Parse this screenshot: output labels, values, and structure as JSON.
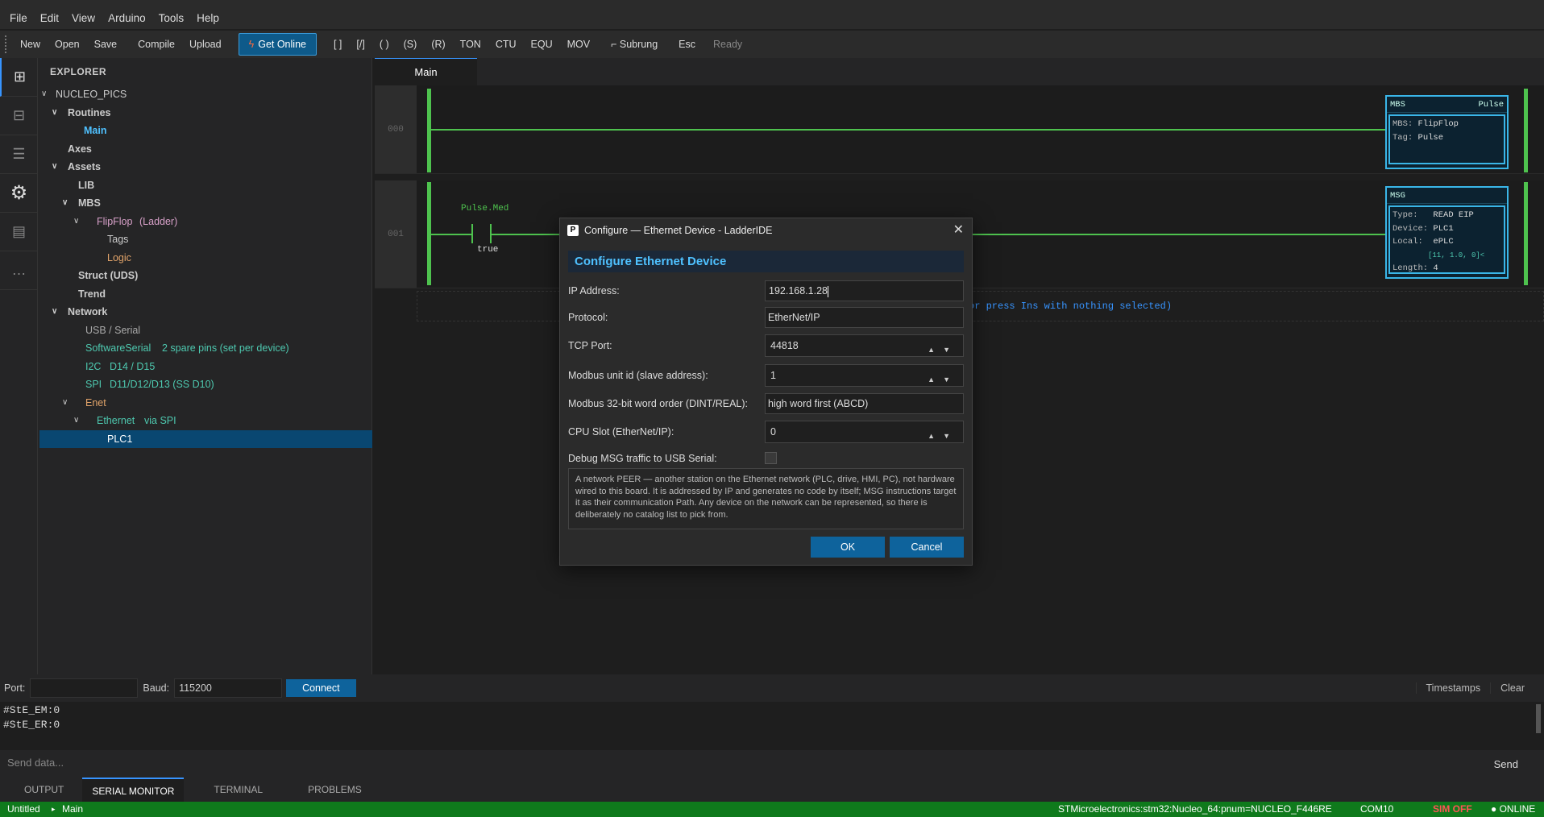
{
  "menu": [
    "File",
    "Edit",
    "View",
    "Arduino",
    "Tools",
    "Help"
  ],
  "toolbar": {
    "new": "New",
    "open": "Open",
    "save": "Save",
    "compile": "Compile",
    "upload": "Upload",
    "get_online": "Get Online",
    "xic": "[ ]",
    "xio": "[/]",
    "ote": "( )",
    "otl": "(S)",
    "otu": "(R)",
    "ton": "TON",
    "ctu": "CTU",
    "equ": "EQU",
    "mov": "MOV",
    "subrung": "⌐ Subrung",
    "esc": "Esc",
    "status": "Ready"
  },
  "explorer": {
    "title": "EXPLORER",
    "project": "NUCLEO_PICS",
    "routines": "Routines",
    "main": "Main",
    "axes": "Axes",
    "assets": "Assets",
    "lib": "LIB",
    "mbs": "MBS",
    "flipflop": "FlipFlop",
    "flipflop_kind": "(Ladder)",
    "tags": "Tags",
    "logic": "Logic",
    "struct": "Struct (UDS)",
    "trend": "Trend",
    "network": "Network",
    "usb": "USB / Serial",
    "softserial": "SoftwareSerial",
    "softserial_note": "2 spare pins (set per device)",
    "i2c": "I2C",
    "i2c_note": "D14 / D15",
    "spi": "SPI",
    "spi_note": "D11/D12/D13 (SS D10)",
    "enet": "Enet",
    "ethernet": "Ethernet",
    "ethernet_note": "via SPI",
    "plc1": "PLC1"
  },
  "editor": {
    "tab": "Main",
    "rung0": {
      "num": "000",
      "block": {
        "name": "MBS",
        "tag_right": "Pulse",
        "l1k": "MBS:",
        "l1v": "FlipFlop",
        "l2k": "Tag:",
        "l2v": "Pulse"
      }
    },
    "rung1": {
      "num": "001",
      "contact_tag": "Pulse.Med",
      "contact_state": "true",
      "block": {
        "name": "MSG",
        "l1k": "Type:",
        "l1v": "READ EIP",
        "l2k": "Device:",
        "l2v": "PLC1",
        "l3k": "Local:",
        "l3v": "ePLC",
        "l4": "[11, 1.0, 0]<",
        "l5k": "Length:",
        "l5v": "4"
      }
    },
    "hint": "or press Ins with nothing selected)"
  },
  "dialog": {
    "title": "Configure — Ethernet Device - LadderIDE",
    "heading": "Configure Ethernet Device",
    "ip_label": "IP Address:",
    "ip_value": "192.168.1.28",
    "protocol_label": "Protocol:",
    "protocol_value": "EtherNet/IP",
    "tcp_label": "TCP Port:",
    "tcp_value": "44818",
    "unit_label": "Modbus unit id (slave address):",
    "unit_value": "1",
    "order_label": "Modbus 32-bit word order (DINT/REAL):",
    "order_value": "high word first (ABCD)",
    "slot_label": "CPU Slot (EtherNet/IP):",
    "slot_value": "0",
    "debug_label": "Debug MSG traffic to USB Serial:",
    "description": "A network PEER — another station on the Ethernet network (PLC, drive, HMI, PC), not hardware wired to this board. It is addressed by IP and generates no code by itself; MSG instructions target it as their communication Path. Any device on the network can be represented, so there is deliberately no catalog list to pick from.",
    "ok": "OK",
    "cancel": "Cancel"
  },
  "serial": {
    "port_label": "Port:",
    "baud_label": "Baud:",
    "baud_value": "115200",
    "connect": "Connect",
    "timestamps": "Timestamps",
    "clear": "Clear",
    "line1": "#StE_EM:0",
    "line2": "#StE_ER:0",
    "send_placeholder": "Send data...",
    "send": "Send"
  },
  "bottom_tabs": [
    "OUTPUT",
    "SERIAL MONITOR",
    "TERMINAL",
    "PROBLEMS"
  ],
  "statusbar": {
    "file": "Untitled",
    "sep": "▸",
    "routine": "Main",
    "board": "STMicroelectronics:stm32:Nucleo_64:pnum=NUCLEO_F446RE",
    "port": "COM10",
    "sim": "SIM OFF",
    "online": "● ONLINE"
  },
  "colors": {
    "accent": "#0e639c",
    "rung": "#4ec24e",
    "block": "#3ab6e8",
    "status_bar": "#0f7a1c",
    "sim_off": "#ff5555"
  }
}
